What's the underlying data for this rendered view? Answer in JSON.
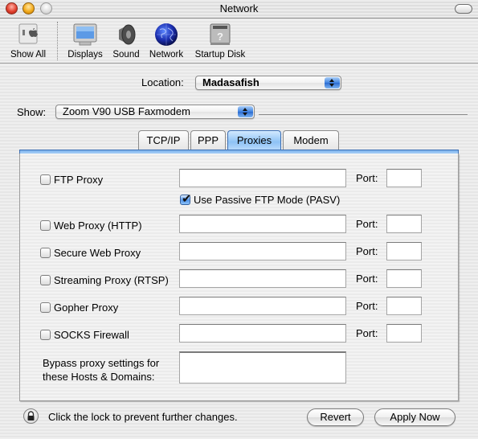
{
  "window": {
    "title": "Network"
  },
  "toolbar": {
    "items": [
      {
        "label": "Show All",
        "icon": "show-all-icon"
      },
      {
        "label": "Displays",
        "icon": "displays-icon"
      },
      {
        "label": "Sound",
        "icon": "sound-icon"
      },
      {
        "label": "Network",
        "icon": "network-globe-icon"
      },
      {
        "label": "Startup Disk",
        "icon": "startup-disk-icon"
      }
    ]
  },
  "location": {
    "label": "Location:",
    "value": "Madasafish"
  },
  "show": {
    "label": "Show:",
    "value": "Zoom V90 USB Faxmodem"
  },
  "tabs": [
    {
      "label": "TCP/IP",
      "active": false
    },
    {
      "label": "PPP",
      "active": false
    },
    {
      "label": "Proxies",
      "active": true
    },
    {
      "label": "Modem",
      "active": false
    }
  ],
  "proxies": {
    "port_label": "Port:",
    "rows": [
      {
        "label": "FTP Proxy",
        "checked": false,
        "server": "",
        "port": ""
      },
      {
        "label": "Web Proxy (HTTP)",
        "checked": false,
        "server": "",
        "port": ""
      },
      {
        "label": "Secure Web Proxy",
        "checked": false,
        "server": "",
        "port": ""
      },
      {
        "label": "Streaming Proxy (RTSP)",
        "checked": false,
        "server": "",
        "port": ""
      },
      {
        "label": "Gopher Proxy",
        "checked": false,
        "server": "",
        "port": ""
      },
      {
        "label": "SOCKS Firewall",
        "checked": false,
        "server": "",
        "port": ""
      }
    ],
    "passive_ftp": {
      "label": "Use Passive FTP Mode (PASV)",
      "checked": true
    },
    "bypass": {
      "label_line1": "Bypass proxy settings for",
      "label_line2": "these Hosts & Domains:",
      "value": ""
    }
  },
  "footer": {
    "lock_text": "Click the lock to prevent further changes.",
    "revert_label": "Revert",
    "apply_label": "Apply Now"
  }
}
